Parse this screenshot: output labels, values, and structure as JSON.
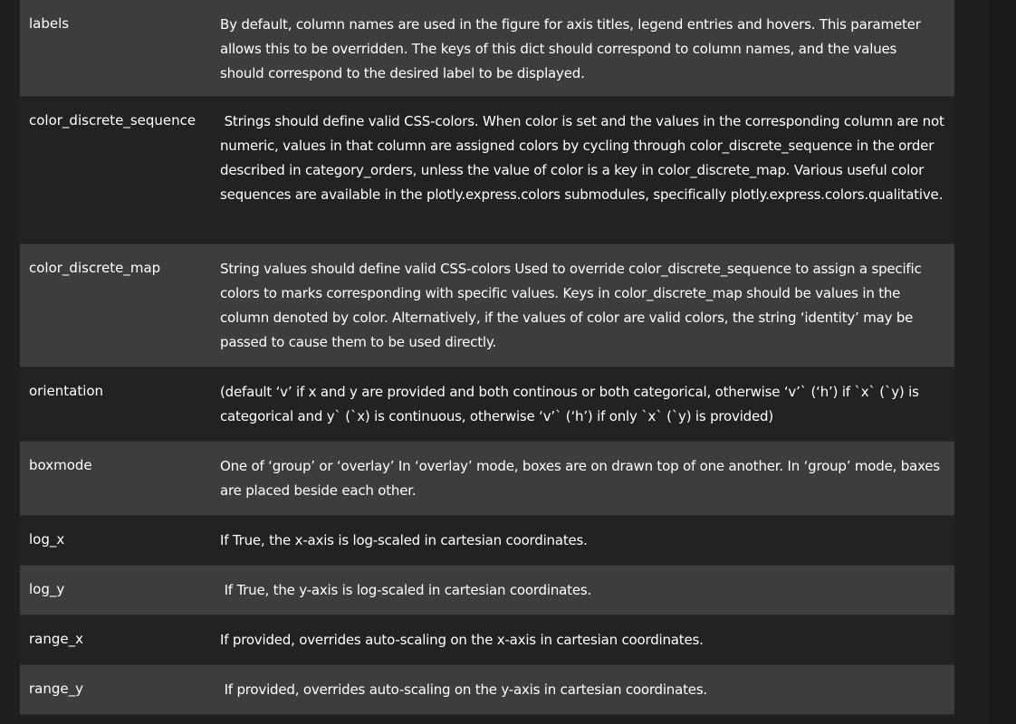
{
  "rows": [
    {
      "param": "labels",
      "description": "By default, column names are used in the figure for axis titles, legend entries and hovers. This parameter allows this to be overridden. The keys of this dict should correspond to column names, and the values should correspond to the desired label to be displayed."
    },
    {
      "param": "color_discrete_sequence",
      "description": " Strings should define valid CSS-colors. When color is set and the values in the corresponding column are not numeric, values in that column are assigned colors by cycling through color_discrete_sequence in the order described in category_orders, unless the value of color is a key in color_discrete_map. Various useful color sequences are available in the plotly.express.colors submodules, specifically plotly.express.colors.qualitative."
    },
    {
      "param": "color_discrete_map",
      "description": "String values should define valid CSS-colors Used to override color_discrete_sequence to assign a specific colors to marks corresponding with specific values. Keys in color_discrete_map should be values in the column denoted by color. Alternatively, if the values of color are valid colors, the string ‘identity’ may be passed to cause them to be used directly."
    },
    {
      "param": "orientation",
      "description": "(default ‘v’ if x and y are provided and both continous or both categorical, otherwise ‘v’` (‘h’) if `x` (`y) is categorical and y` (`x) is continuous, otherwise ‘v’` (‘h’) if only `x` (`y) is provided)"
    },
    {
      "param": "boxmode",
      "description": "One of ‘group’ or ‘overlay’ In ‘overlay’ mode, boxes are on drawn top of one another. In ‘group’ mode, baxes are placed beside each other."
    },
    {
      "param": "log_x",
      "description": "If True, the x-axis is log-scaled in cartesian coordinates."
    },
    {
      "param": "log_y",
      "description": " If True, the y-axis is log-scaled in cartesian coordinates."
    },
    {
      "param": "range_x",
      "description": "If provided, overrides auto-scaling on the x-axis in cartesian coordinates."
    },
    {
      "param": "range_y",
      "description": " If provided, overrides auto-scaling on the y-axis in cartesian coordinates."
    }
  ]
}
